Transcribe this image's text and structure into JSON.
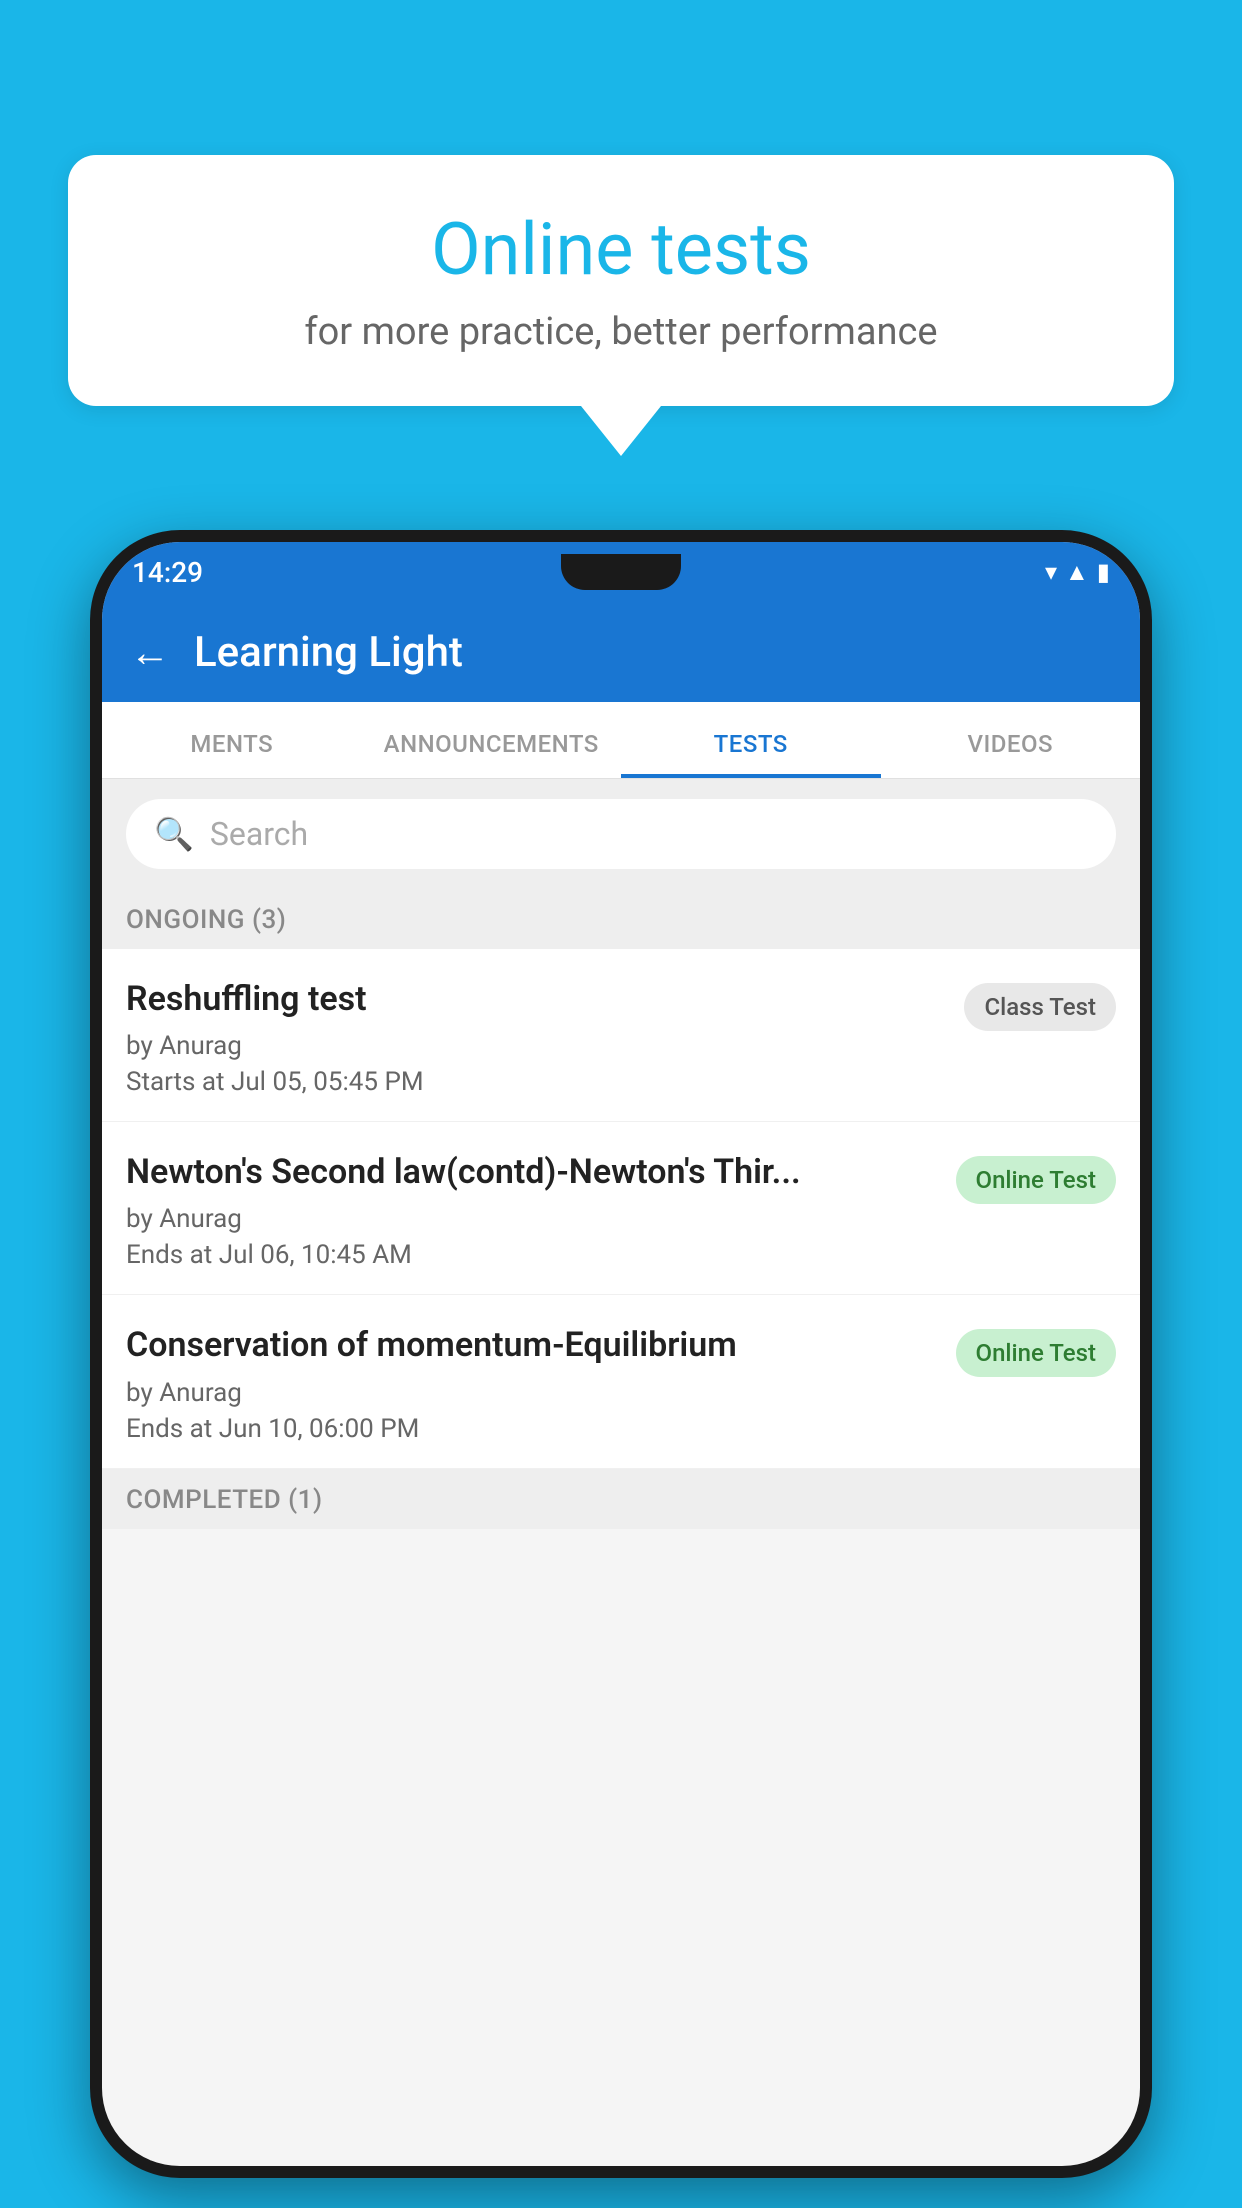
{
  "background_color": "#1ab6e8",
  "speech_bubble": {
    "title": "Online tests",
    "subtitle": "for more practice, better performance"
  },
  "phone": {
    "status_bar": {
      "time": "14:29",
      "icons": [
        "wifi",
        "signal",
        "battery"
      ]
    },
    "app_header": {
      "back_label": "←",
      "title": "Learning Light"
    },
    "tabs": [
      {
        "label": "MENTS",
        "active": false
      },
      {
        "label": "ANNOUNCEMENTS",
        "active": false
      },
      {
        "label": "TESTS",
        "active": true
      },
      {
        "label": "VIDEOS",
        "active": false
      }
    ],
    "search": {
      "placeholder": "Search"
    },
    "sections": [
      {
        "title": "ONGOING (3)",
        "tests": [
          {
            "name": "Reshuffling test",
            "author": "by Anurag",
            "date": "Starts at  Jul 05, 05:45 PM",
            "badge": "Class Test",
            "badge_type": "class"
          },
          {
            "name": "Newton's Second law(contd)-Newton's Thir...",
            "author": "by Anurag",
            "date": "Ends at  Jul 06, 10:45 AM",
            "badge": "Online Test",
            "badge_type": "online"
          },
          {
            "name": "Conservation of momentum-Equilibrium",
            "author": "by Anurag",
            "date": "Ends at  Jun 10, 06:00 PM",
            "badge": "Online Test",
            "badge_type": "online"
          }
        ]
      }
    ],
    "completed_section": {
      "title": "COMPLETED (1)"
    }
  }
}
